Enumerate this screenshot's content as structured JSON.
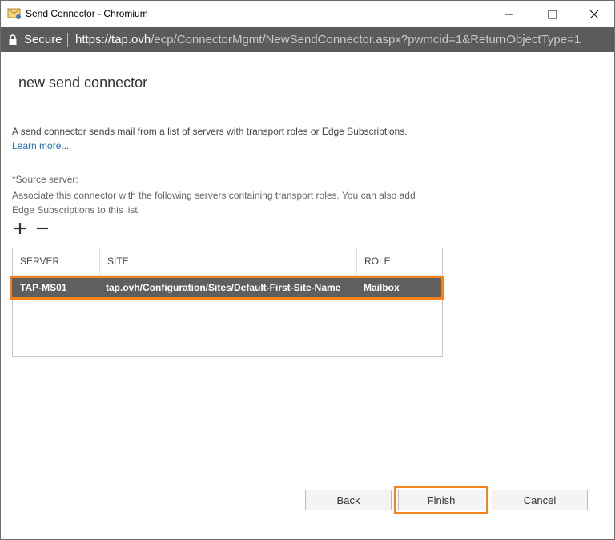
{
  "window": {
    "title": "Send Connector - Chromium"
  },
  "address_bar": {
    "secure_label": "Secure",
    "url_host": "https://tap.ovh",
    "url_path": "/ecp/ConnectorMgmt/NewSendConnector.aspx?pwmcid=1&ReturnObjectType=1"
  },
  "page": {
    "title": "new send connector",
    "description": "A send connector sends mail from a list of servers with transport roles or Edge Subscriptions.",
    "learn_more": "Learn more...",
    "source_label": "*Source server:",
    "source_description": "Associate this connector with the following servers containing transport roles. You can also add Edge Subscriptions to this list."
  },
  "grid": {
    "headers": {
      "server": "SERVER",
      "site": "SITE",
      "role": "ROLE"
    },
    "rows": [
      {
        "server": "TAP-MS01",
        "site": "tap.ovh/Configuration/Sites/Default-First-Site-Name",
        "role": "Mailbox",
        "selected": true
      }
    ]
  },
  "buttons": {
    "back": "Back",
    "finish": "Finish",
    "cancel": "Cancel"
  },
  "colors": {
    "highlight": "#f58220",
    "selected_row": "#5f5f5f",
    "address_bar": "#5b5b5b",
    "link": "#1e6fc0"
  },
  "icons": [
    "app-icon",
    "minimize-icon",
    "maximize-icon",
    "close-icon",
    "lock-icon",
    "add-icon",
    "remove-icon"
  ]
}
